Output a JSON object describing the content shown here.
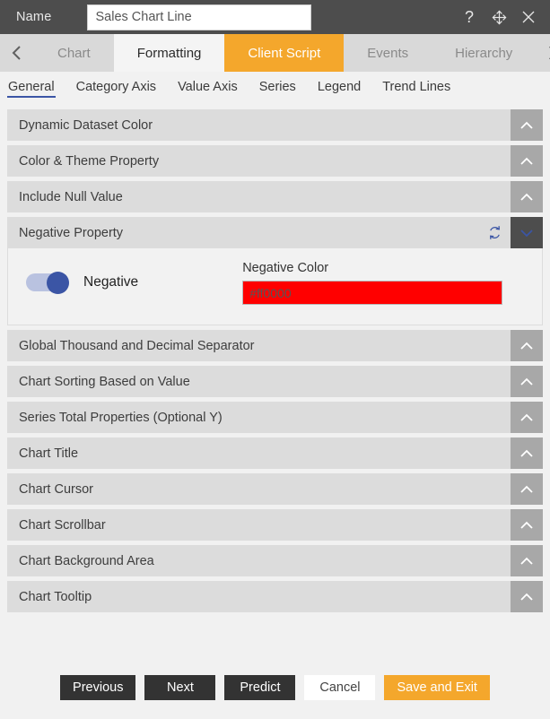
{
  "titlebar": {
    "name_label": "Name",
    "name_value": "Sales Chart Line",
    "help_icon": "question-mark-icon",
    "move_icon": "move-arrows-icon",
    "close_icon": "close-x-icon"
  },
  "tabbar": {
    "prev_icon": "chevron-left-icon",
    "next_icon": "chevron-right-icon",
    "tabs": [
      {
        "label": "Chart",
        "state": "inactive"
      },
      {
        "label": "Formatting",
        "state": "active"
      },
      {
        "label": "Client Script",
        "state": "highlight"
      },
      {
        "label": "Events",
        "state": "inactive"
      },
      {
        "label": "Hierarchy",
        "state": "inactive"
      }
    ]
  },
  "subtabs": [
    {
      "label": "General",
      "active": true
    },
    {
      "label": "Category Axis",
      "active": false
    },
    {
      "label": "Value Axis",
      "active": false
    },
    {
      "label": "Series",
      "active": false
    },
    {
      "label": "Legend",
      "active": false
    },
    {
      "label": "Trend Lines",
      "active": false
    }
  ],
  "accordion": [
    {
      "title": "Dynamic Dataset Color",
      "expanded": false
    },
    {
      "title": "Color & Theme Property",
      "expanded": false
    },
    {
      "title": "Include Null Value",
      "expanded": false
    },
    {
      "title": "Negative Property",
      "expanded": true
    },
    {
      "title": "Global Thousand and Decimal Separator",
      "expanded": false
    },
    {
      "title": "Chart Sorting Based on Value",
      "expanded": false
    },
    {
      "title": "Series Total Properties (Optional Y)",
      "expanded": false
    },
    {
      "title": "Chart Title",
      "expanded": false
    },
    {
      "title": "Chart Cursor",
      "expanded": false
    },
    {
      "title": "Chart Scrollbar",
      "expanded": false
    },
    {
      "title": "Chart Background Area",
      "expanded": false
    },
    {
      "title": "Chart Tooltip",
      "expanded": false
    }
  ],
  "negative_panel": {
    "refresh_icon": "refresh-sync-icon",
    "collapse_icon": "chevron-down-icon",
    "toggle_label": "Negative",
    "toggle_on": true,
    "color_label": "Negative Color",
    "color_value": "#ff0000",
    "color_swatch": "#ff0000"
  },
  "footer": {
    "buttons": [
      {
        "label": "Previous",
        "style": "dark"
      },
      {
        "label": "Next",
        "style": "dark"
      },
      {
        "label": "Predict",
        "style": "dark"
      },
      {
        "label": "Cancel",
        "style": "light"
      },
      {
        "label": "Save and Exit",
        "style": "accent"
      }
    ]
  },
  "colors": {
    "titlebar_bg": "#4d4d4d",
    "accent": "#f4a72c",
    "toggle_on": "#3b55a5",
    "negative": "#ff0000",
    "page_bg": "#f1f1f1"
  }
}
